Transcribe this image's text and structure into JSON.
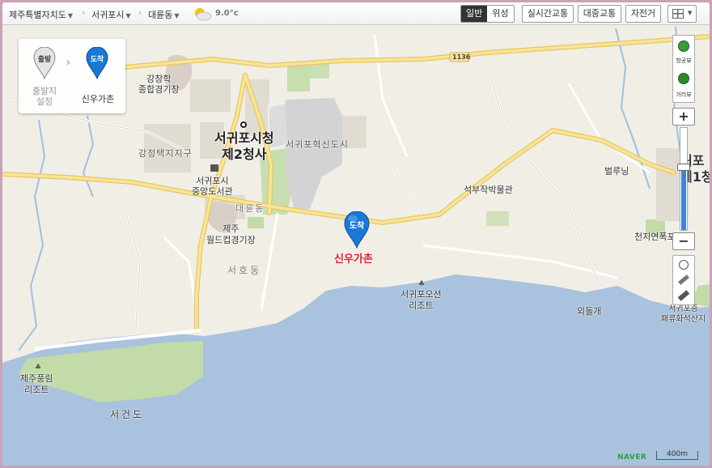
{
  "breadcrumb": {
    "province": "제주특별자치도",
    "city": "서귀포시",
    "district": "대륜동",
    "temperature": "9.0°c"
  },
  "map_modes": {
    "normal": "일반",
    "satellite": "위성",
    "active": "일반"
  },
  "toolbar": {
    "traffic": "실시간교통",
    "transit": "대중교통",
    "bicycle": "자전거"
  },
  "route": {
    "start_badge": "출발",
    "start_label_1": "출발지",
    "start_label_2": "설정",
    "end_badge": "도착",
    "end_label": "신우가촌"
  },
  "controls": {
    "aerial": "항공뷰",
    "street": "거리뷰",
    "zoom_in": "+",
    "zoom_out": "−"
  },
  "map_labels": {
    "road_number": "1136",
    "stadium_1": "강창학",
    "stadium_2": "종합경기장",
    "city_hall_1": "서귀포시청",
    "city_hall_2": "제2청사",
    "innovation_city": "서귀포혁신도시",
    "gangjeong": "강정택지지구",
    "library_1": "서귀포시",
    "library_2": "중앙도서관",
    "daeryun": "대륜동",
    "worldcup_1": "제주",
    "worldcup_2": "월드컵경기장",
    "seoho": "서호동",
    "seokbuljak": "석부작박물관",
    "beolluning": "벌루닝",
    "destination_marker": "도착",
    "destination_name": "신우가촌",
    "resort_1": "서귀포오션",
    "resort_2": "리조트",
    "oedolgae": "외돌개",
    "cheonjiyeon": "천지연폭포",
    "city_hall_edge_1": "귀포",
    "city_hall_edge_2": "제1청",
    "edge_bottom_1": "서귀포층",
    "edge_bottom_2": "패류화석산지",
    "pungnim_1": "제주풍림",
    "pungnim_2": "리조트",
    "seogeondo": "서건도"
  },
  "footer": {
    "brand": "NAVER",
    "scale": "400m"
  },
  "colors": {
    "land": "#f1eee6",
    "sea": "#a9c2de",
    "green": "#c2dba8",
    "road_major": "#f5d97e",
    "marker_blue": "#1a78d6",
    "destination_text": "#e3172c"
  }
}
